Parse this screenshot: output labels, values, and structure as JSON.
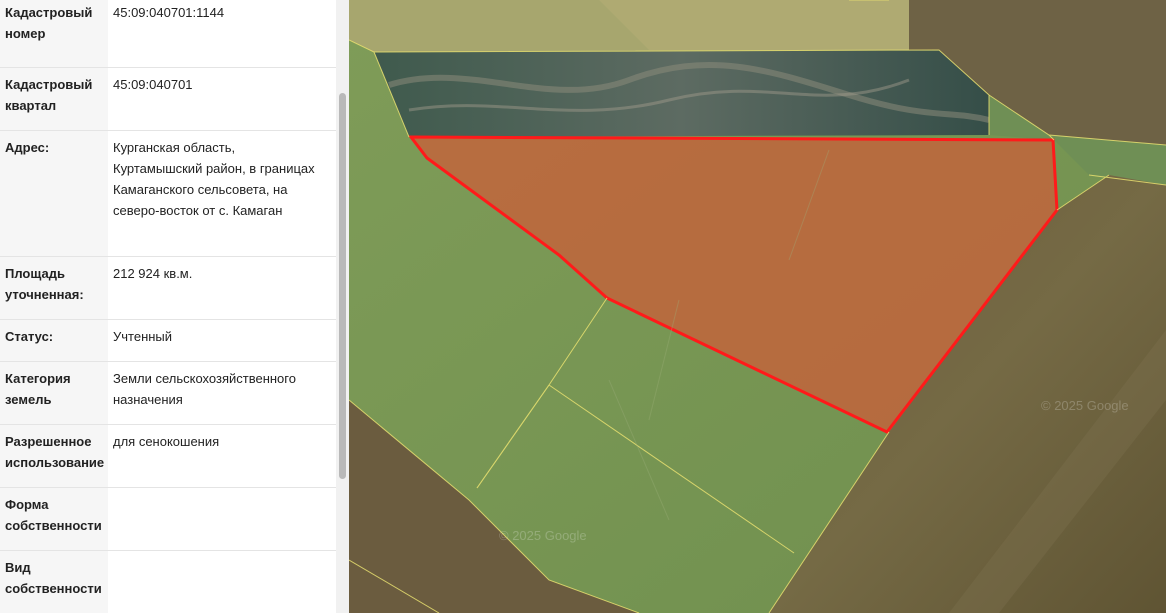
{
  "parcel_info": {
    "rows": [
      {
        "label": "Кадастровый номер",
        "value": "45:09:040701:1144"
      },
      {
        "label": "Кадастровый квартал",
        "value": "45:09:040701"
      },
      {
        "label": "Адрес:",
        "value": "Курганская область, Куртамышский район, в границах Камаганского сельсовета, на северо-восток от с. Камаган"
      },
      {
        "label": "Площадь уточненная:",
        "value": "212 924 кв.м."
      },
      {
        "label": "Статус:",
        "value": "Учтенный"
      },
      {
        "label": "Категория земель",
        "value": "Земли сельскохозяйственного назначения"
      },
      {
        "label": "Разрешенное использование",
        "value": "для сенокошения"
      },
      {
        "label": "Форма собственности",
        "value": ""
      },
      {
        "label": "Вид собственности",
        "value": ""
      }
    ]
  },
  "map": {
    "watermarks": [
      "© 2025 Google",
      "© 2025 Google"
    ],
    "colors": {
      "selected_parcel_outline": "#ff1a1a",
      "selected_parcel_fill": "#c8603a",
      "parcel_boundaries": "#e8e070"
    }
  }
}
